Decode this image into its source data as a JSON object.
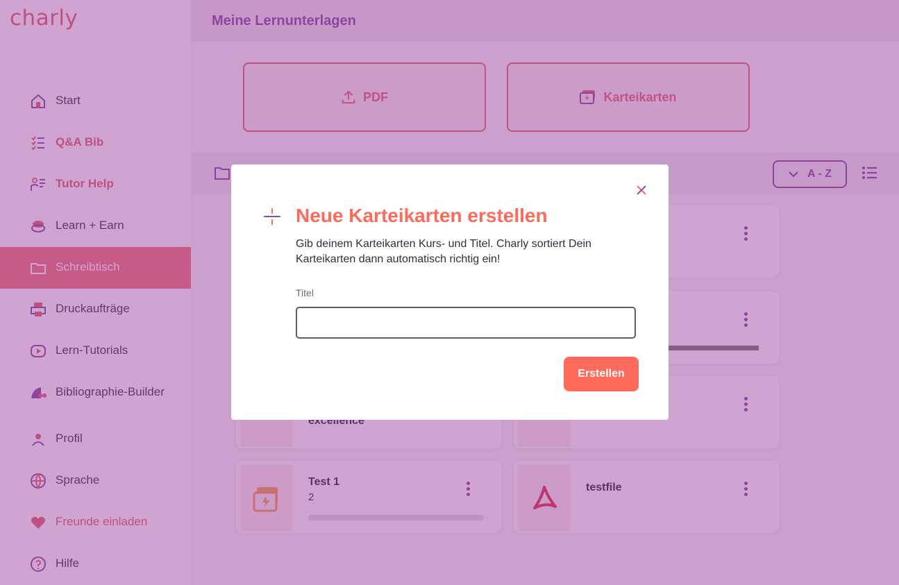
{
  "brand": {
    "logo": "charly",
    "accent": "#e0686e",
    "primary": "#8a4fa9",
    "cta": "#ff6a5a"
  },
  "sidebar": {
    "items": [
      {
        "label": "Start",
        "icon": "home-icon"
      },
      {
        "label": "Q&A Bib",
        "icon": "checklist-icon"
      },
      {
        "label": "Tutor Help",
        "icon": "tutor-icon"
      },
      {
        "label": "Learn + Earn",
        "icon": "coins-icon"
      },
      {
        "label": "Schreibtisch",
        "icon": "folder-icon"
      },
      {
        "label": "Druckaufträge",
        "icon": "printer-icon"
      },
      {
        "label": "Lern-Tutorials",
        "icon": "play-icon"
      },
      {
        "label": "Bibliographie-Builder",
        "icon": "quote-icon"
      },
      {
        "label": "Profil",
        "icon": "user-icon"
      },
      {
        "label": "Sprache",
        "icon": "globe-icon"
      },
      {
        "label": "Freunde einladen",
        "icon": "heart-icon"
      },
      {
        "label": "Hilfe",
        "icon": "help-icon"
      }
    ]
  },
  "header": {
    "title": "Meine Lernunterlagen"
  },
  "upload": {
    "pdf_label": "PDF",
    "flashcards_label": "Karteikarten"
  },
  "toolbar": {
    "sort_label": "A - Z"
  },
  "cards": [
    {
      "title": "excellence"
    },
    {
      "title": "Test 1",
      "subtitle": "2",
      "progress": 0
    },
    {
      "title": "testfile"
    }
  ],
  "modal": {
    "title": "Neue Karteikarten erstellen",
    "description": "Gib deinem Karteikarten Kurs- und Titel. Charly sortiert Dein Karteikarten dann automatisch richtig ein!",
    "field_label": "Titel",
    "field_value": "",
    "button_label": "Erstellen"
  }
}
